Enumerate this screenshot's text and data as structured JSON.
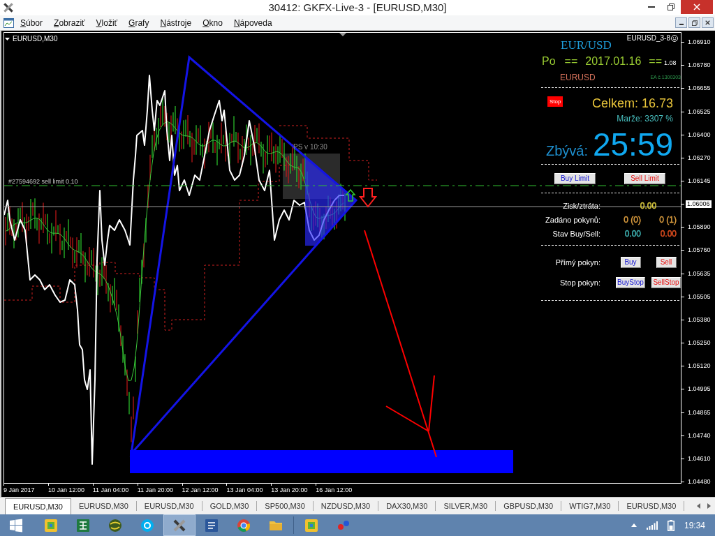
{
  "window": {
    "title": "30412: GKFX-Live-3 - [EURUSD,M30]"
  },
  "menu": [
    "Súbor",
    "Zobraziť",
    "Vložiť",
    "Grafy",
    "Nástroje",
    "Okno",
    "Nápoveda"
  ],
  "chart": {
    "symbol": "EURUSD,M30",
    "indicator": "EURUSD_3-8",
    "order_label": "#27594692 sell limit 0.10",
    "session_label": "PS v 10:30",
    "price_axis": [
      {
        "text": "1.06910",
        "current": false
      },
      {
        "text": "1.06780",
        "current": false
      },
      {
        "text": "1.06655",
        "current": false
      },
      {
        "text": "1.06525",
        "current": false
      },
      {
        "text": "1.06400",
        "current": false
      },
      {
        "text": "1.06270",
        "current": false
      },
      {
        "text": "1.06145",
        "current": false
      },
      {
        "text": "1.06006",
        "current": true
      },
      {
        "text": "1.05890",
        "current": false
      },
      {
        "text": "1.05760",
        "current": false
      },
      {
        "text": "1.05635",
        "current": false
      },
      {
        "text": "1.05505",
        "current": false
      },
      {
        "text": "1.05380",
        "current": false
      },
      {
        "text": "1.05250",
        "current": false
      },
      {
        "text": "1.05120",
        "current": false
      },
      {
        "text": "1.04995",
        "current": false
      },
      {
        "text": "1.04865",
        "current": false
      },
      {
        "text": "1.04740",
        "current": false
      },
      {
        "text": "1.04610",
        "current": false
      },
      {
        "text": "1.04480",
        "current": false
      }
    ],
    "time_axis": [
      "9 Jan 2017",
      "10 Jan 12:00",
      "11 Jan 04:00",
      "11 Jan 20:00",
      "12 Jan 12:00",
      "13 Jan 04:00",
      "13 Jan 20:00",
      "16 Jan 12:00"
    ]
  },
  "panel": {
    "pair": "EUR/USD",
    "date_line": {
      "day": "Po",
      "left_mark": "==",
      "date": "2017.01.16",
      "right_mark": "==",
      "suffix": "1.08"
    },
    "symbol": "EURUSD",
    "ea_label": "EA č.1300303",
    "stop_button": "Stop",
    "total": "Celkem: 16.73",
    "margin": "Marže: 3307 %",
    "remaining": {
      "label": "Zbývá:",
      "time": "25:59"
    },
    "limit_buttons": [
      {
        "label": "Buy Limit",
        "kind": "buy"
      },
      {
        "label": "Sell Limit",
        "kind": "sell"
      }
    ],
    "stats": [
      {
        "label": "Zisk/ztráta:",
        "values": [
          {
            "text": "0.00",
            "color": "#e0d040"
          }
        ]
      },
      {
        "label": "Zadáno pokynů:",
        "values": [
          {
            "text": "0 (0)",
            "color": "#e0a040"
          },
          {
            "text": "0 (1)",
            "color": "#e0a040"
          }
        ]
      },
      {
        "label": "Stav Buy/Sell:",
        "values": [
          {
            "text": "0.00",
            "color": "#40b8b8"
          },
          {
            "text": "0.00",
            "color": "#e85020"
          }
        ]
      }
    ],
    "orders": [
      {
        "label": "Přímý pokyn:",
        "buttons": [
          {
            "label": "Buy",
            "kind": "buy"
          },
          {
            "label": "Sell",
            "kind": "sell"
          }
        ]
      },
      {
        "label": "Stop pokyn:",
        "buttons": [
          {
            "label": "BuyStop",
            "kind": "buy"
          },
          {
            "label": "SellStop",
            "kind": "sell"
          }
        ]
      }
    ]
  },
  "tabs": [
    {
      "label": "EURUSD,M30",
      "selected": true
    },
    {
      "label": "EURUSD,M30",
      "selected": false
    },
    {
      "label": "EURUSD,M30",
      "selected": false
    },
    {
      "label": "GOLD,M30",
      "selected": false
    },
    {
      "label": "SP500,M30",
      "selected": false
    },
    {
      "label": "NZDUSD,M30",
      "selected": false
    },
    {
      "label": "DAX30,M30",
      "selected": false
    },
    {
      "label": "SILVER,M30",
      "selected": false
    },
    {
      "label": "GBPUSD,M30",
      "selected": false
    },
    {
      "label": "WTIG7,M30",
      "selected": false
    },
    {
      "label": "EURUSD,M30",
      "selected": false
    }
  ],
  "taskbar": {
    "app_groups": [
      [
        {
          "kind": "photos",
          "selected": false
        },
        {
          "kind": "sheet",
          "selected": false
        },
        {
          "kind": "globe",
          "selected": false
        },
        {
          "kind": "chat",
          "selected": false
        },
        {
          "kind": "trading",
          "selected": true
        },
        {
          "kind": "document",
          "selected": false
        },
        {
          "kind": "browser",
          "selected": false
        },
        {
          "kind": "folder",
          "selected": false
        }
      ],
      [
        {
          "kind": "photos",
          "selected": false
        },
        {
          "kind": "dots",
          "selected": false
        }
      ]
    ],
    "clock": "19:34"
  }
}
